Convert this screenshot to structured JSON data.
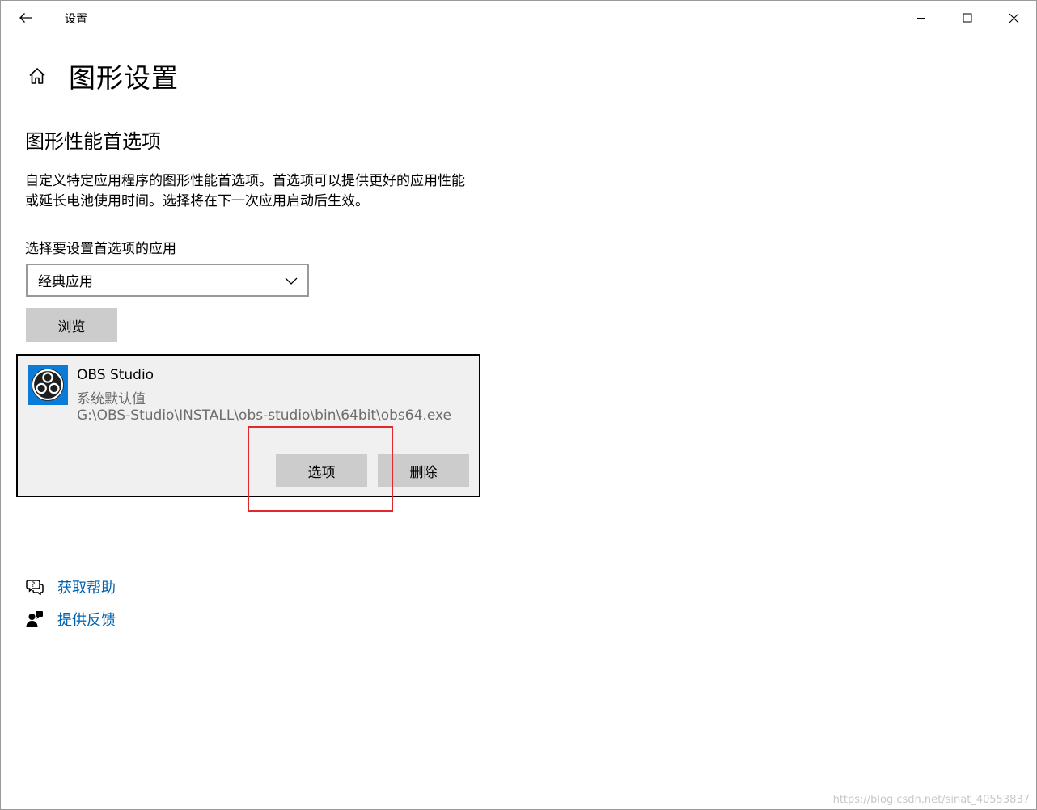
{
  "window": {
    "title": "设置"
  },
  "page": {
    "title": "图形设置"
  },
  "section": {
    "title": "图形性能首选项",
    "description": "自定义特定应用程序的图形性能首选项。首选项可以提供更好的应用性能或延长电池使用时间。选择将在下一次应用启动后生效。"
  },
  "app_selector": {
    "label": "选择要设置首选项的应用",
    "selected": "经典应用",
    "browse_label": "浏览"
  },
  "app_entry": {
    "name": "OBS Studio",
    "preference": "系统默认值",
    "path": "G:\\OBS-Studio\\INSTALL\\obs-studio\\bin\\64bit\\obs64.exe",
    "options_label": "选项",
    "remove_label": "删除",
    "icon": "obs-logo-icon"
  },
  "links": {
    "help": "获取帮助",
    "feedback": "提供反馈"
  },
  "watermark": "https://blog.csdn.net/sinat_40553837",
  "colors": {
    "link": "#0063b1",
    "highlight": "#e0282e",
    "button_bg": "#cccccc",
    "card_bg": "#f0f0f0",
    "app_icon_bg": "#0a7bd7"
  }
}
